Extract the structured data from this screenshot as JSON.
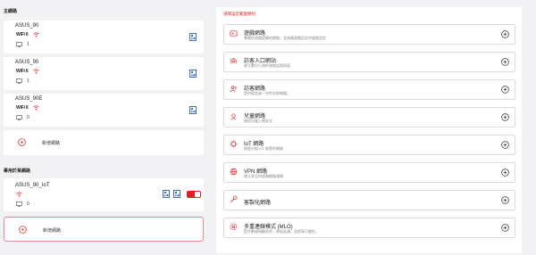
{
  "colors": {
    "accent": "#d9282e",
    "qr_blue": "#3b6fc2"
  },
  "left": {
    "main_section_title": "主網路",
    "networks": [
      {
        "name": "ASUS_90",
        "badge": "WiFi 6",
        "devices": "1"
      },
      {
        "name": "ASUS_90",
        "badge": "WiFi 6",
        "devices": "1"
      },
      {
        "name": "ASUS_90E",
        "badge": "WiFi 6",
        "devices": "0"
      }
    ],
    "add_network_label": "新增網路",
    "iot_section_title": "專用於某網路",
    "iot_network": {
      "name": "ASUS_90_IoT",
      "devices": "0",
      "enabled": true
    },
    "add_network_label_2": "新增網路"
  },
  "right": {
    "title": "選擇設定範圍類別",
    "options": [
      {
        "icon": "game-network-icon",
        "title": "遊戲網路",
        "desc": "專屬於遊戲設備的網路，並具備遊戲設定的優質設定"
      },
      {
        "icon": "guest-portal-icon",
        "title": "訪客入口網站",
        "desc": "建立數位行銷的強制認證頁面"
      },
      {
        "icon": "guest-network-icon",
        "title": "訪客網路",
        "desc": "提供限定或一次性存取網路。"
      },
      {
        "icon": "kids-network-icon",
        "title": "兒童網路",
        "desc": "確保兒童上網安全"
      },
      {
        "icon": "iot-network-icon",
        "title": "IoT 網路",
        "desc": "輕鬆分組 IoT 裝置的網路"
      },
      {
        "icon": "vpn-network-icon",
        "title": "VPN 網路",
        "desc": "建立安全的遠端網路連線"
      },
      {
        "icon": "custom-network-icon",
        "title": "客製化網路",
        "desc": ""
      },
      {
        "icon": "mlo-icon",
        "title": "多重連線模式 (MLO)",
        "desc": "提升數據傳輸效率，降低延遲，並提高可靠性。"
      }
    ]
  }
}
